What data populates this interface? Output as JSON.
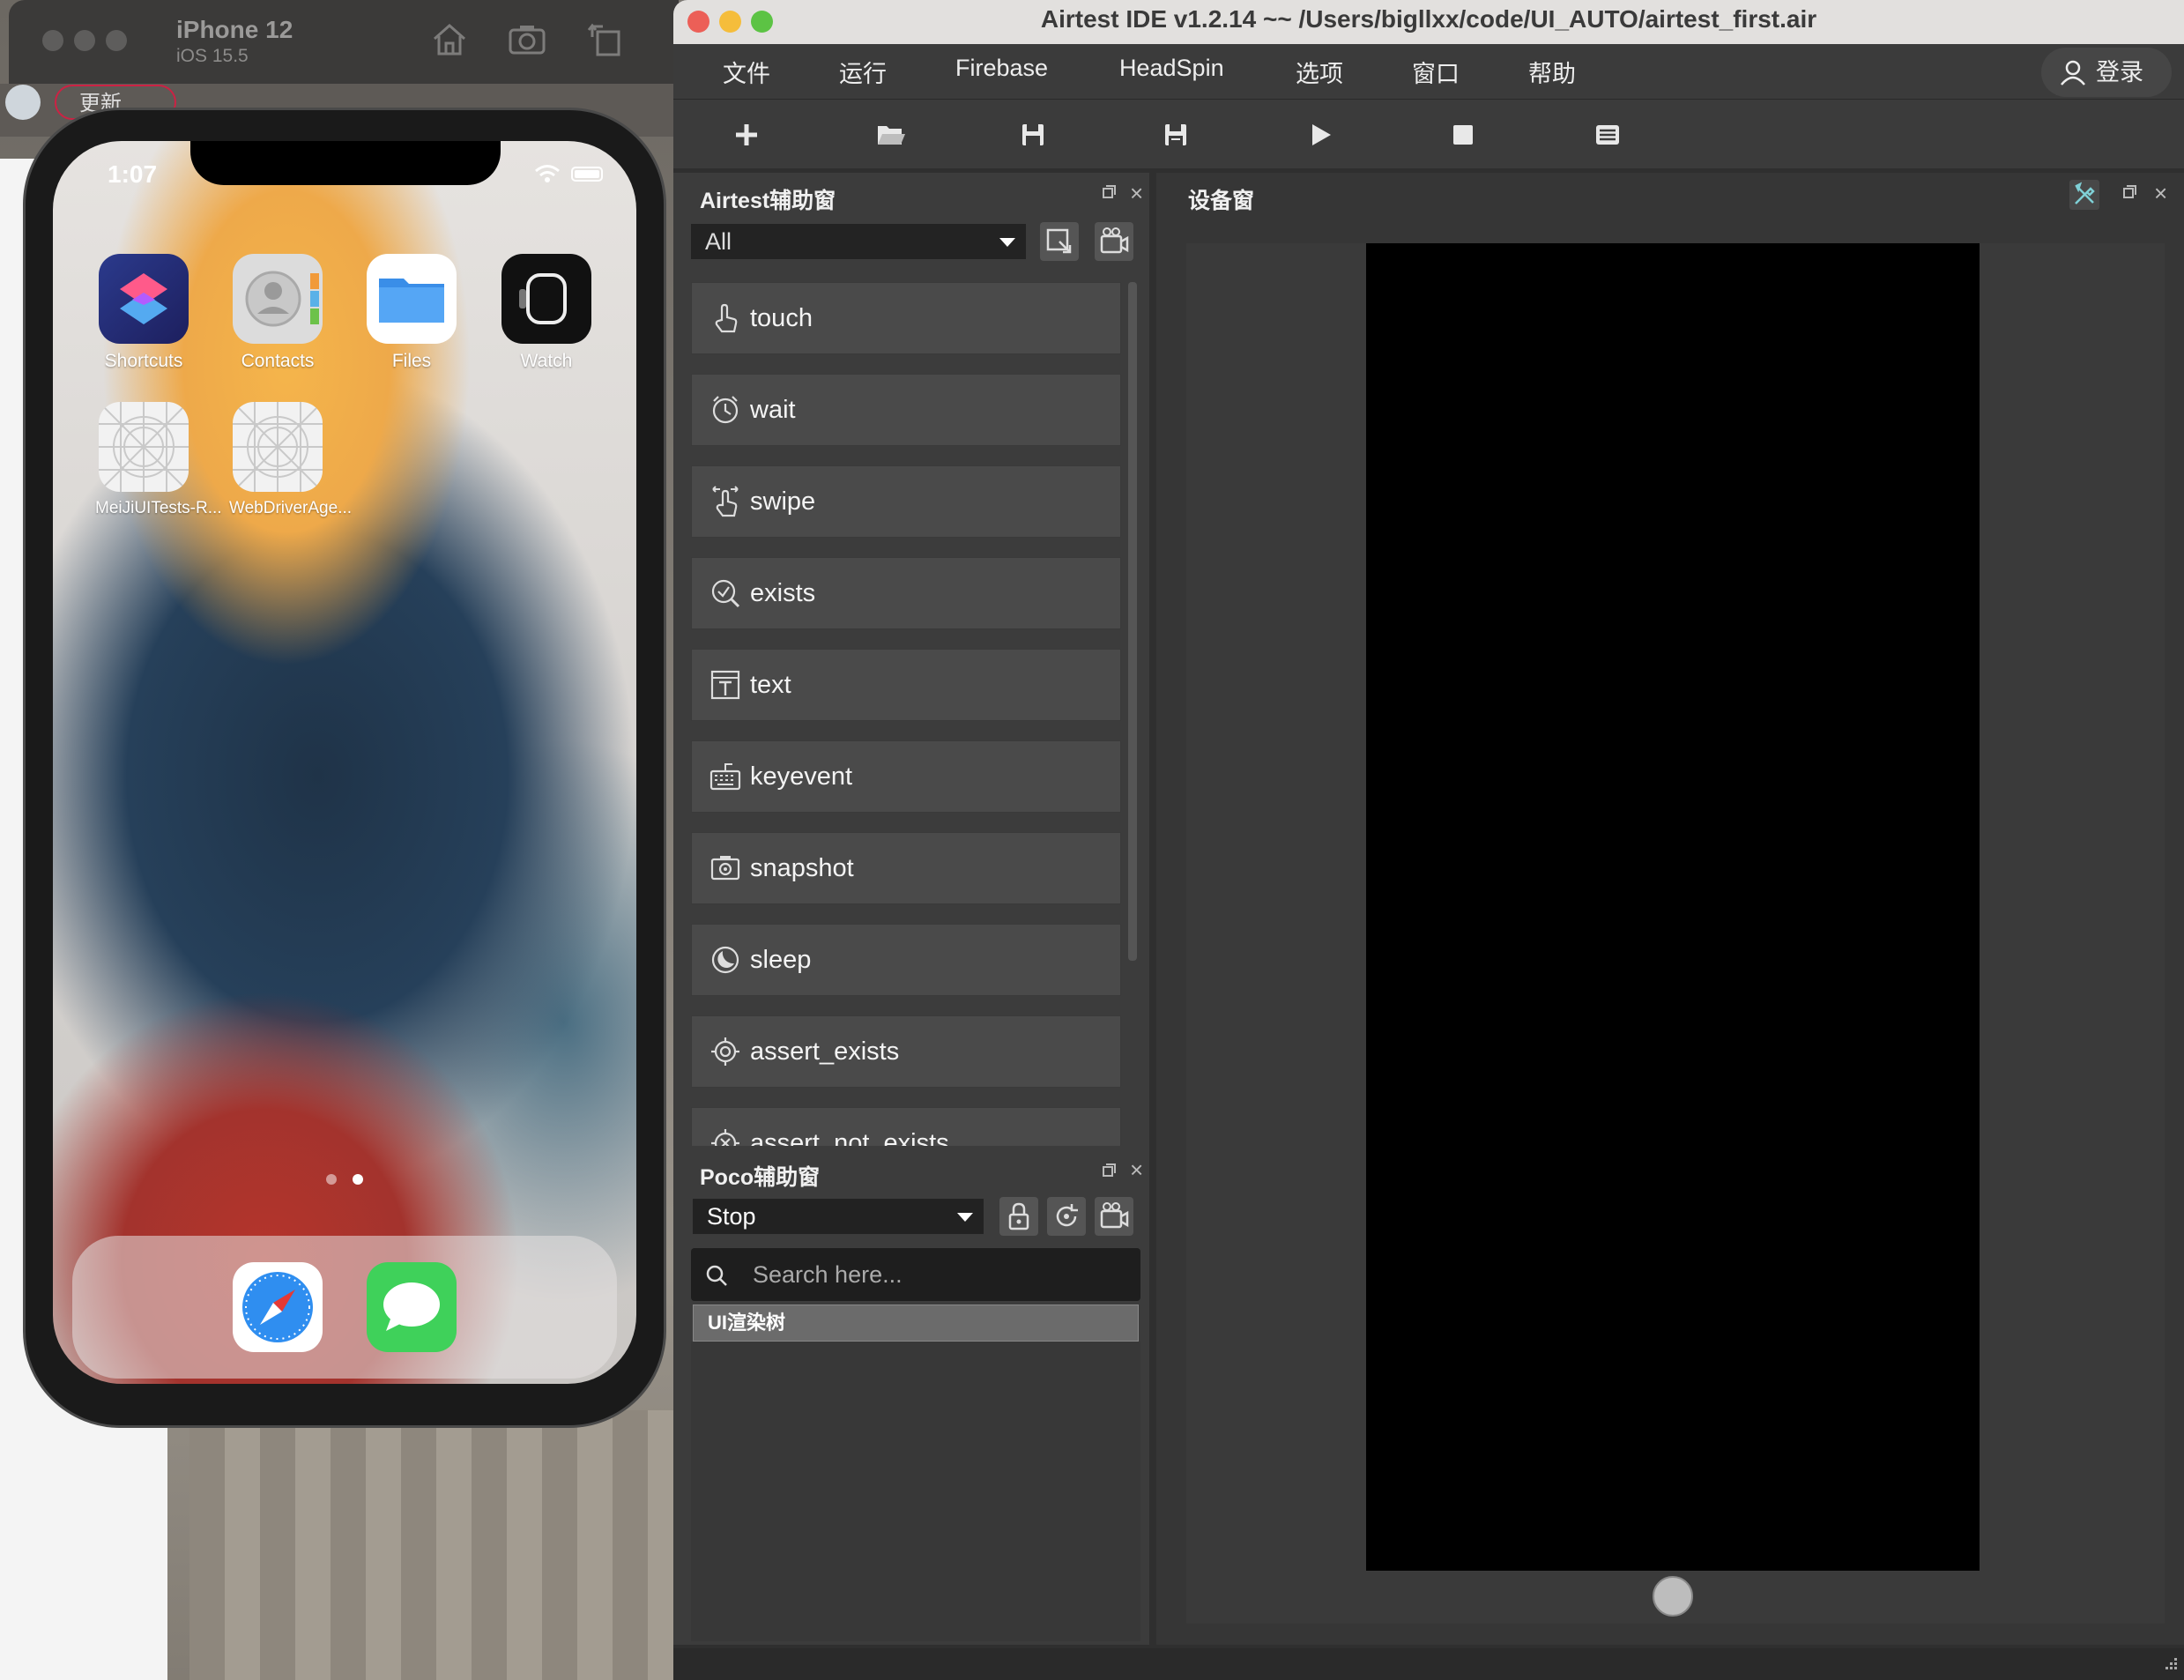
{
  "simulator": {
    "device_name": "iPhone 12",
    "os_version": "iOS 15.5",
    "update_label": "更新",
    "home_button_icon": "home-icon",
    "screenshot_button_icon": "camera-icon",
    "rotate_button_icon": "rotate-icon"
  },
  "phone": {
    "time": "1:07",
    "apps": [
      {
        "name": "Shortcuts",
        "icon": "shortcuts-icon"
      },
      {
        "name": "Contacts",
        "icon": "contacts-icon"
      },
      {
        "name": "Files",
        "icon": "files-icon"
      },
      {
        "name": "Watch",
        "icon": "watch-icon"
      },
      {
        "name": "MeiJiUITests-R...",
        "icon": "placeholder-app-icon"
      },
      {
        "name": "WebDriverAge...",
        "icon": "placeholder-app-icon"
      }
    ],
    "dock": [
      {
        "name": "Safari",
        "icon": "safari-icon"
      },
      {
        "name": "Messages",
        "icon": "messages-icon"
      }
    ],
    "page_count": 2,
    "current_page": 2
  },
  "ide": {
    "title": "Airtest IDE v1.2.14 ~~ /Users/bigllxx/code/UI_AUTO/airtest_first.air",
    "menu": [
      "文件",
      "运行",
      "Firebase",
      "HeadSpin",
      "选项",
      "窗口",
      "帮助"
    ],
    "login_label": "登录",
    "toolbar_icons": [
      "new-file-icon",
      "open-folder-icon",
      "save-icon",
      "save-as-icon",
      "run-icon",
      "stop-icon",
      "log-icon"
    ],
    "airtest_panel": {
      "title": "Airtest辅助窗",
      "filter_value": "All",
      "apis": [
        {
          "label": "touch",
          "icon": "touch-icon"
        },
        {
          "label": "wait",
          "icon": "clock-icon"
        },
        {
          "label": "swipe",
          "icon": "swipe-icon"
        },
        {
          "label": "exists",
          "icon": "check-circle-icon"
        },
        {
          "label": "text",
          "icon": "text-icon"
        },
        {
          "label": "keyevent",
          "icon": "keyboard-icon"
        },
        {
          "label": "snapshot",
          "icon": "camera-icon"
        },
        {
          "label": "sleep",
          "icon": "moon-icon"
        },
        {
          "label": "assert_exists",
          "icon": "target-icon"
        },
        {
          "label": "assert_not_exists",
          "icon": "target-x-icon"
        }
      ]
    },
    "poco_panel": {
      "title": "Poco辅助窗",
      "mode_value": "Stop",
      "search_placeholder": "Search here...",
      "tree_root": "UI渲染树"
    },
    "device_panel": {
      "title": "设备窗"
    }
  }
}
